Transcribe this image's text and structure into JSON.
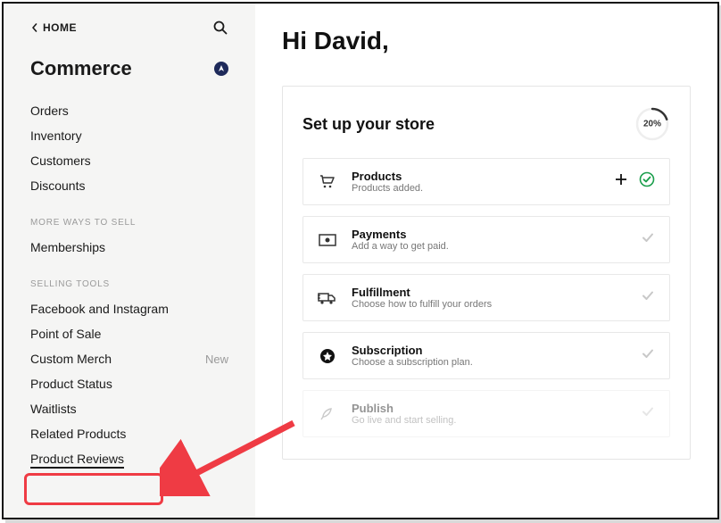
{
  "sidebar": {
    "home": "HOME",
    "title": "Commerce",
    "sections": {
      "primary": [
        {
          "label": "Orders"
        },
        {
          "label": "Inventory"
        },
        {
          "label": "Customers"
        },
        {
          "label": "Discounts"
        }
      ],
      "moreWaysHeading": "MORE WAYS TO SELL",
      "moreWays": [
        {
          "label": "Memberships"
        }
      ],
      "sellingHeading": "SELLING TOOLS",
      "selling": [
        {
          "label": "Facebook and Instagram"
        },
        {
          "label": "Point of Sale"
        },
        {
          "label": "Custom Merch",
          "badge": "New"
        },
        {
          "label": "Product Status"
        },
        {
          "label": "Waitlists"
        },
        {
          "label": "Related Products"
        },
        {
          "label": "Product Reviews"
        }
      ]
    }
  },
  "main": {
    "greeting": "Hi David,",
    "panel": {
      "title": "Set up your store",
      "progressLabel": "20%",
      "progressValue": 20,
      "steps": [
        {
          "title": "Products",
          "sub": "Products added.",
          "done": true,
          "addable": true
        },
        {
          "title": "Payments",
          "sub": "Add a way to get paid."
        },
        {
          "title": "Fulfillment",
          "sub": "Choose how to fulfill your orders"
        },
        {
          "title": "Subscription",
          "sub": "Choose a subscription plan."
        },
        {
          "title": "Publish",
          "sub": "Go live and start selling.",
          "disabled": true
        }
      ]
    }
  }
}
